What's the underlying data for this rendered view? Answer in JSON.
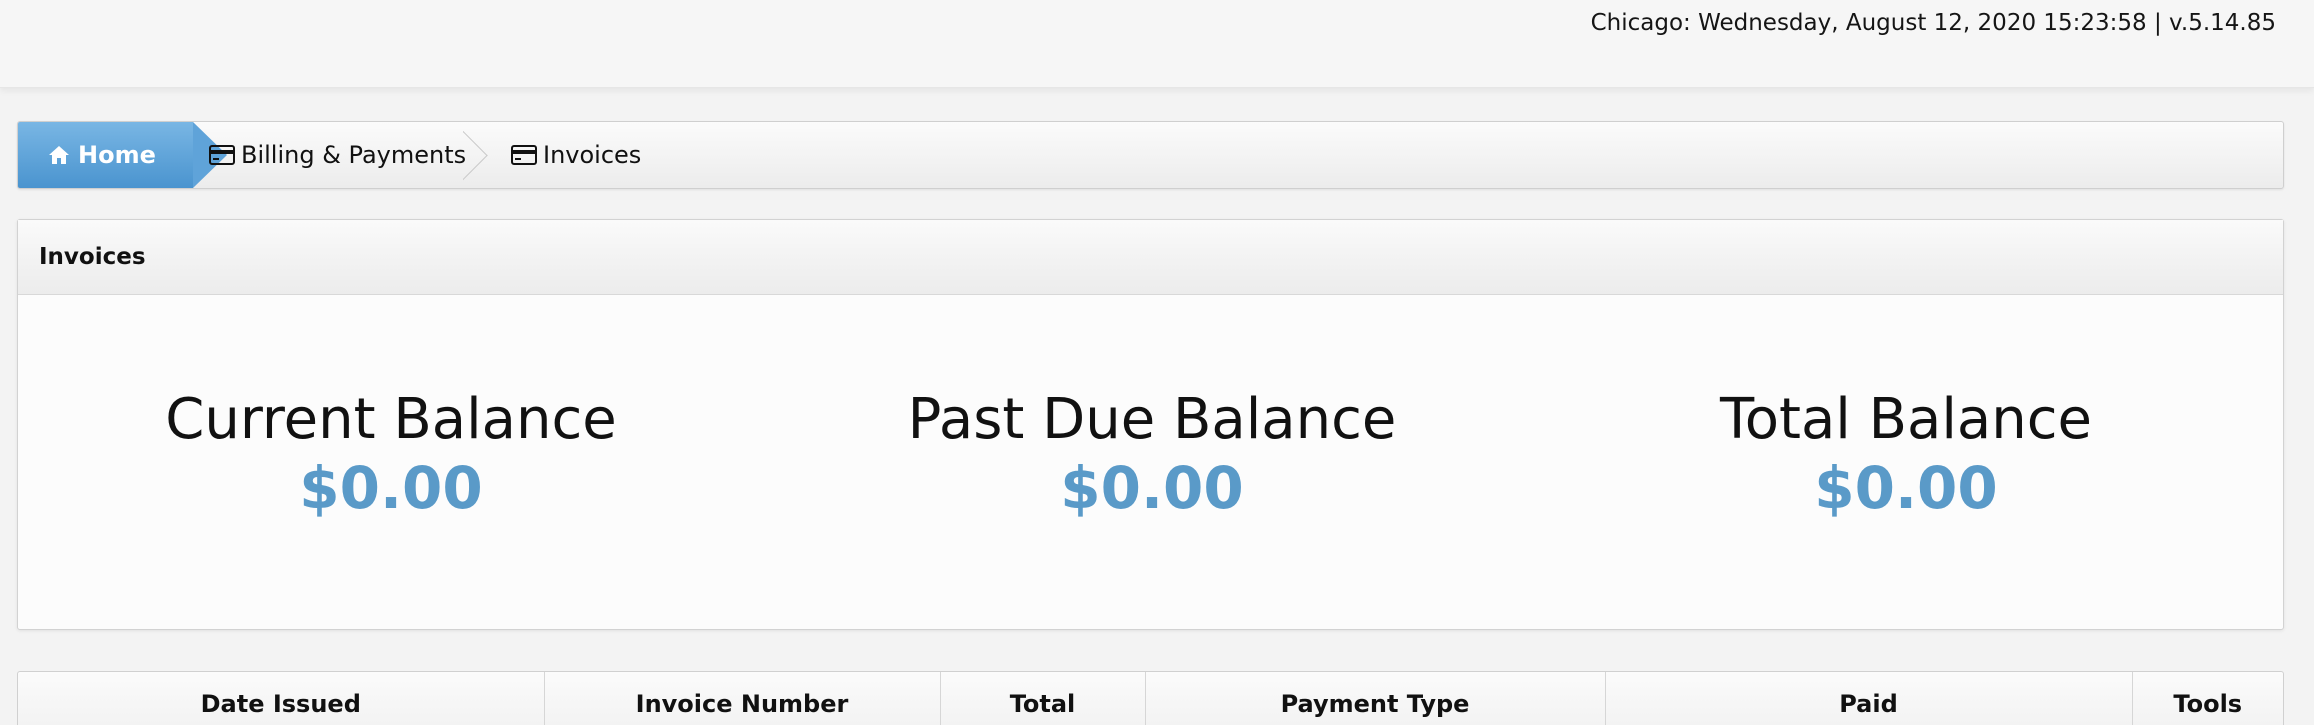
{
  "header": {
    "clock_text": "Chicago: Wednesday, August 12, 2020 15:23:58 | v.5.14.85"
  },
  "breadcrumb": {
    "home": "Home",
    "billing": "Billing & Payments",
    "invoices": "Invoices"
  },
  "panel": {
    "title": "Invoices",
    "balances": [
      {
        "label": "Current Balance",
        "value": "$0.00"
      },
      {
        "label": "Past Due Balance",
        "value": "$0.00"
      },
      {
        "label": "Total Balance",
        "value": "$0.00"
      }
    ]
  },
  "table": {
    "columns": [
      "Date Issued",
      "Invoice Number",
      "Total",
      "Payment Type",
      "Paid",
      "Tools"
    ]
  },
  "colors": {
    "accent": "#5a9ac8",
    "home_crumb": "#4a94cf"
  }
}
